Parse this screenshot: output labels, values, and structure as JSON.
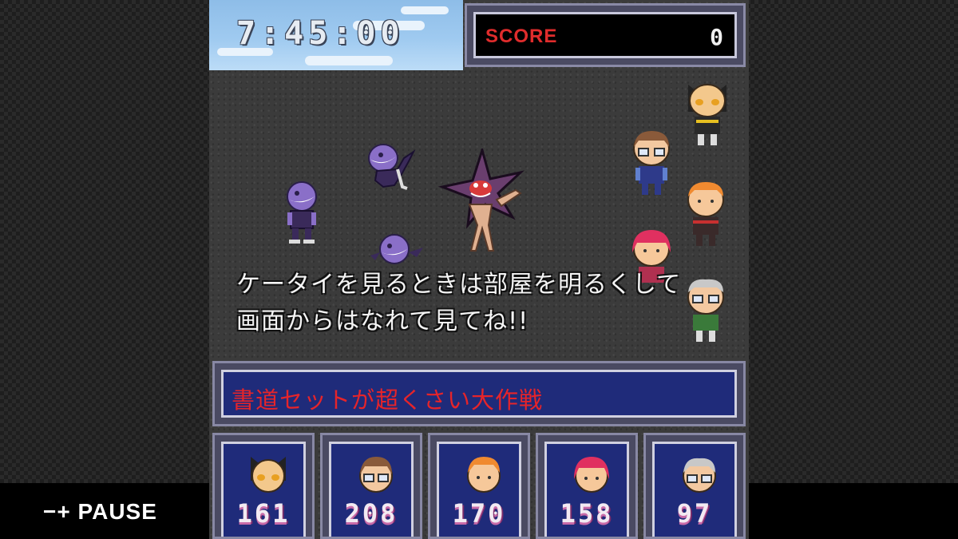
{
  "hud": {
    "time": "7:45:00",
    "score_label": "SCORE",
    "score_value": "0"
  },
  "dialog": {
    "line1": "ケータイを見るときは部屋を明るくして",
    "line2": "画面からはなれて見てね!!"
  },
  "mission": {
    "title": "書道セットが超くさい大作戦"
  },
  "party": [
    {
      "hp": "161",
      "face": "bald-cat-ear-face-icon",
      "hair": "#f0b060"
    },
    {
      "hp": "208",
      "face": "brown-hair-glasses-face-icon",
      "hair": "#8a5a3a"
    },
    {
      "hp": "170",
      "face": "orange-hair-face-icon",
      "hair": "#f08a30"
    },
    {
      "hp": "158",
      "face": "pink-hair-face-icon",
      "hair": "#e03060"
    },
    {
      "hp": "97",
      "face": "grandma-face-icon",
      "hair": "#c8c8c8"
    }
  ],
  "controls": {
    "minus": "−",
    "plus": "+",
    "pause": "PAUSE"
  },
  "colors": {
    "panel_blue": "#1f2b7a",
    "score_red": "#e02c2c",
    "title_red": "#e6242a",
    "enemy_purple": "#8a6fc8"
  }
}
